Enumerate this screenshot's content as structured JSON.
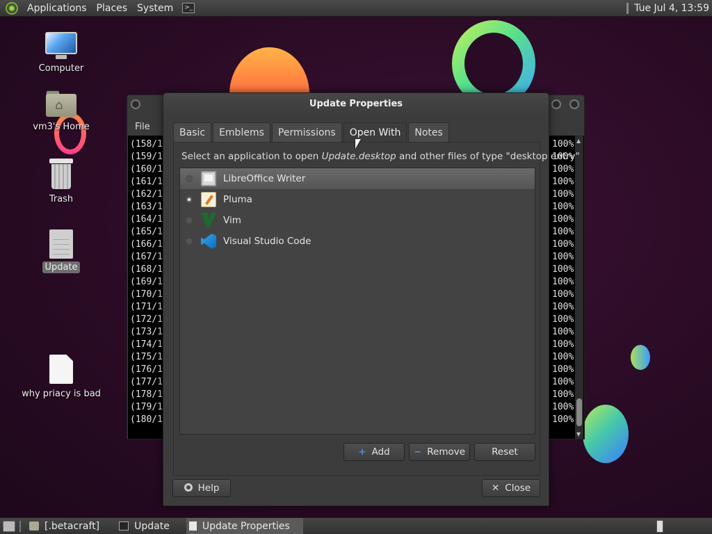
{
  "top_panel": {
    "menus": [
      "Applications",
      "Places",
      "System"
    ],
    "clock": "Tue Jul  4, 13:59"
  },
  "desktop_icons": [
    {
      "label": "Computer"
    },
    {
      "label": "vm3's Home"
    },
    {
      "label": "Trash"
    },
    {
      "label": "Update"
    },
    {
      "label": "why priacy is bad"
    }
  ],
  "terminal": {
    "menu_file": "File",
    "lines": [
      "(158/1",
      "(159/1",
      "(160/1",
      "(161/1",
      "(162/1",
      "(163/1",
      "(164/1",
      "(165/1",
      "(166/1",
      "(167/1",
      "(168/1",
      "(169/1",
      "(170/1",
      "(171/1",
      "(172/1",
      "(173/1",
      "(174/1",
      "(175/1",
      "(176/1",
      "(177/1",
      "(178/1",
      "(179/1",
      "(180/1"
    ],
    "percent": "100%"
  },
  "dialog": {
    "title": "Update Properties",
    "tabs": [
      "Basic",
      "Emblems",
      "Permissions",
      "Open With",
      "Notes"
    ],
    "active_tab": "Open With",
    "instruction_prefix": "Select an application to open ",
    "instruction_file": "Update.desktop",
    "instruction_suffix": " and other files of type \"desktop entry\"",
    "apps": [
      {
        "name": "LibreOffice Writer",
        "icon": "libreoffice-writer-icon",
        "selected": true,
        "default": false
      },
      {
        "name": "Pluma",
        "icon": "pluma-icon",
        "selected": false,
        "default": true
      },
      {
        "name": "Vim",
        "icon": "vim-icon",
        "selected": false,
        "default": false
      },
      {
        "name": "Visual Studio Code",
        "icon": "vscode-icon",
        "selected": false,
        "default": false
      }
    ],
    "buttons": {
      "add": "Add",
      "remove": "Remove",
      "reset": "Reset",
      "help": "Help",
      "close": "Close"
    }
  },
  "taskbar": {
    "tasks": [
      {
        "label": "[.betacraft]",
        "icon": "folder-icon",
        "active": false
      },
      {
        "label": "Update",
        "icon": "terminal-icon",
        "active": false
      },
      {
        "label": "Update Properties",
        "icon": "document-icon",
        "active": true
      }
    ]
  }
}
